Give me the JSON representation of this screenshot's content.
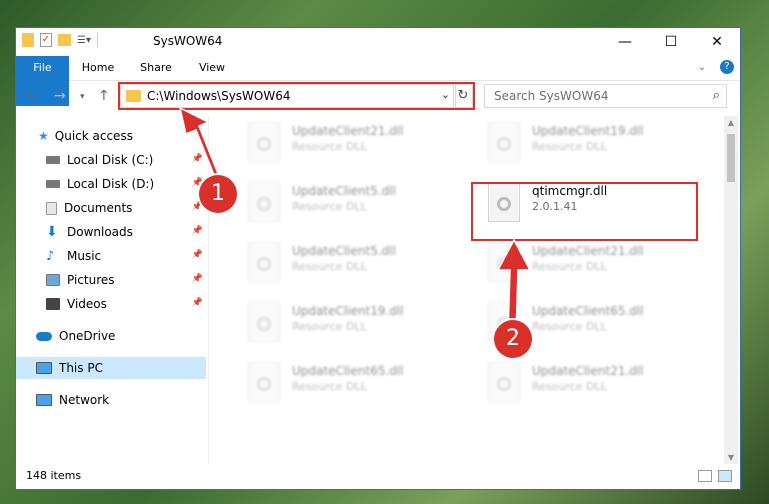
{
  "window": {
    "title": "SysWOW64"
  },
  "ribbon": {
    "tabs": [
      "File",
      "Home",
      "Share",
      "View"
    ]
  },
  "address": {
    "path": "C:\\Windows\\SysWOW64"
  },
  "search": {
    "placeholder": "Search SysWOW64"
  },
  "sidebar": {
    "items": [
      {
        "label": "Quick access",
        "icon": "star-icon"
      },
      {
        "label": "Local Disk (C:)",
        "icon": "drive-icon"
      },
      {
        "label": "Local Disk (D:)",
        "icon": "drive-icon"
      },
      {
        "label": "Documents",
        "icon": "documents-icon"
      },
      {
        "label": "Downloads",
        "icon": "download-icon"
      },
      {
        "label": "Music",
        "icon": "music-icon"
      },
      {
        "label": "Pictures",
        "icon": "pictures-icon"
      },
      {
        "label": "Videos",
        "icon": "videos-icon"
      },
      {
        "label": "OneDrive",
        "icon": "cloud-icon"
      },
      {
        "label": "This PC",
        "icon": "computer-icon"
      },
      {
        "label": "Network",
        "icon": "network-icon"
      }
    ]
  },
  "files": [
    {
      "name": "UpdateClient21.dll",
      "sub": "Resource DLL"
    },
    {
      "name": "UpdateClient19.dll",
      "sub": "Resource DLL"
    },
    {
      "name": "UpdateClient5.dll",
      "sub": "Resource DLL"
    },
    {
      "name": "qtimcmgr.dll",
      "sub": "2.0.1.41"
    },
    {
      "name": "UpdateClient5.dll",
      "sub": "Resource DLL"
    },
    {
      "name": "UpdateClient21.dll",
      "sub": "Resource DLL"
    },
    {
      "name": "UpdateClient19.dll",
      "sub": "Resource DLL"
    },
    {
      "name": "UpdateClient65.dll",
      "sub": "Resource DLL"
    },
    {
      "name": "UpdateClient65.dll",
      "sub": "Resource DLL"
    },
    {
      "name": "UpdateClient21.dll",
      "sub": "Resource DLL"
    }
  ],
  "status": {
    "count": "148 items"
  },
  "markers": [
    "1",
    "2"
  ],
  "colors": {
    "accent": "#1979ca",
    "highlight": "#d9302c",
    "selected": "#cce8ff"
  }
}
